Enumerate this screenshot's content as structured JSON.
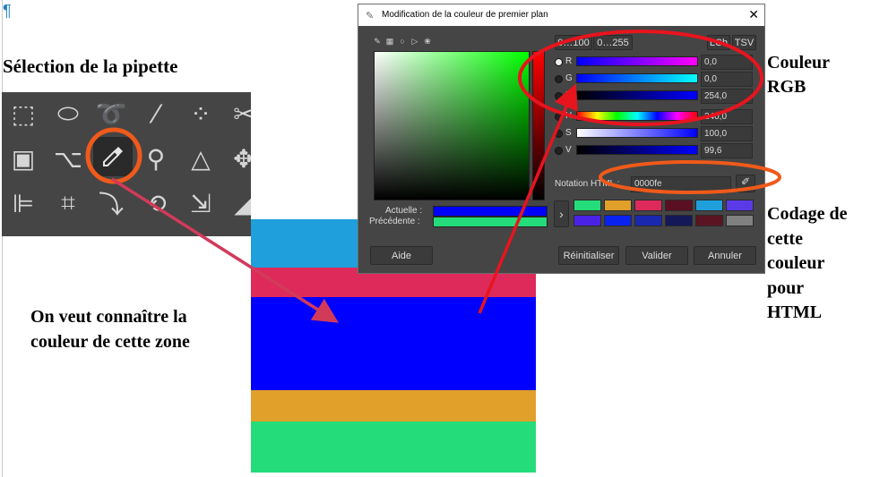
{
  "document": {
    "pilcrow": "¶",
    "heading": "Sélection de la pipette",
    "note_left_1": "On veut connaître la",
    "note_left_2": "couleur de cette zone",
    "note_rgb_1": "Couleur",
    "note_rgb_2": "RGB",
    "note_html": [
      "Codage de",
      "cette",
      "couleur",
      "pour",
      "HTML"
    ]
  },
  "toolbox": {
    "tools": [
      "rect-select-icon",
      "ellipse-select-icon",
      "lasso-icon",
      "fuzzy-select-icon",
      "color-select-icon",
      "scissors-icon",
      "foreground-select-icon",
      "paths-icon",
      "color-picker-icon",
      "magnify-icon",
      "measure-icon",
      "move-icon",
      "align-icon",
      "crop-icon",
      "unified-transform-icon",
      "rotate-icon",
      "scale-icon",
      "shear-icon"
    ],
    "active": "color-picker-icon"
  },
  "stripes": [
    {
      "color": "#1f9fdc"
    },
    {
      "color": "#dd2a5a"
    },
    {
      "color": "#0000fe"
    },
    {
      "color": "#e0a02a"
    },
    {
      "color": "#25dc7a"
    }
  ],
  "dialog": {
    "title": "Modification de la couleur de premier plan",
    "close": "✕",
    "range_100": "0…100",
    "range_255": "0…255",
    "mode_lch": "LCh",
    "mode_tsv": "TSV",
    "channels": [
      {
        "label": "R",
        "value": "0,0"
      },
      {
        "label": "G",
        "value": "0,0"
      },
      {
        "label": "B",
        "value": "254,0"
      },
      {
        "label": "H",
        "value": "240,0"
      },
      {
        "label": "S",
        "value": "100,0"
      },
      {
        "label": "V",
        "value": "99,6"
      }
    ],
    "html_label": "Notation HTML :",
    "html_value": "0000fe",
    "current_label": "Actuelle :",
    "previous_label": "Précédente :",
    "current_color": "#0000fe",
    "previous_color": "#25dc7a",
    "history_colors": [
      "#25dc7a",
      "#e0a02a",
      "#dd2a5a",
      "#5a1022",
      "#1f9fdc",
      "#5a3ae6",
      "#4a22e6",
      "#0a22f0",
      "#1a28b0",
      "#141858",
      "#5a1422",
      "#808080"
    ],
    "buttons": {
      "help": "Aide",
      "reset": "Réinitialiser",
      "ok": "Valider",
      "cancel": "Annuler"
    },
    "arrow": "›"
  },
  "colors": {
    "annotation_orange": "#f05a1a",
    "annotation_red": "#e8141e",
    "arrow_crimson": "#d23a5a"
  }
}
